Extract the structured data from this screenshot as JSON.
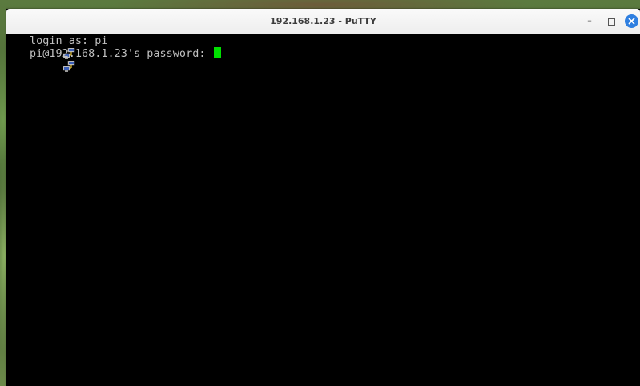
{
  "window": {
    "title": "192.168.1.23 - PuTTY",
    "minimize_glyph": "–"
  },
  "terminal": {
    "lines": [
      {
        "icon": "network-computers-icon",
        "text": "login as: pi"
      },
      {
        "icon": "network-computers-icon",
        "text": "pi@192.168.1.23's password: "
      }
    ],
    "cursor_color": "#00e000",
    "background": "#000000",
    "foreground": "#bfbfbf"
  },
  "colors": {
    "close_button": "#2f7fe0"
  }
}
